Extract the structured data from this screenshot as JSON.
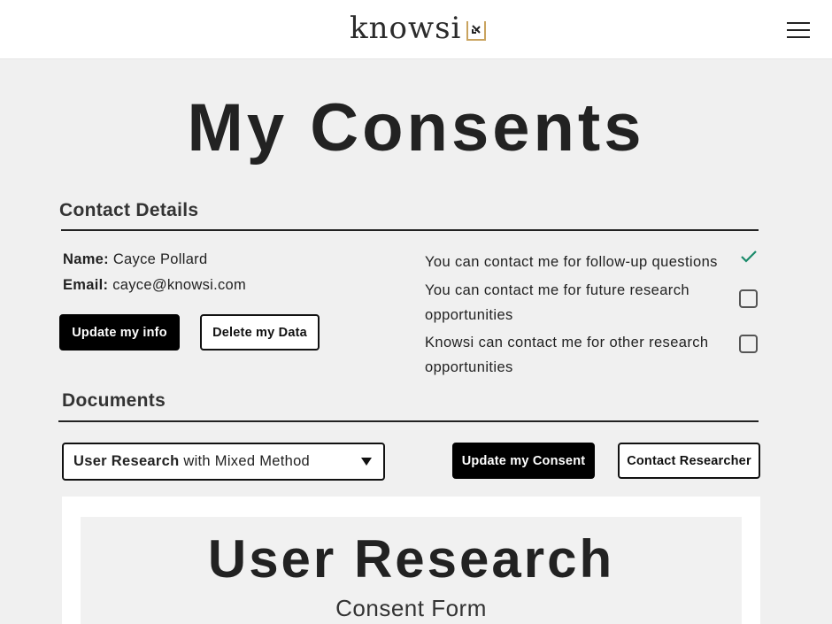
{
  "header": {
    "logo_text": "knowsi",
    "logo_icon": "knowsi-mark-icon",
    "menu_icon": "hamburger-menu-icon"
  },
  "page_title": "My Consents",
  "contact": {
    "heading": "Contact Details",
    "name_label": "Name:",
    "name_value": "Cayce Pollard",
    "email_label": "Email:",
    "email_value": "cayce@knowsi.com",
    "update_label": "Update my info",
    "delete_label": "Delete my Data"
  },
  "preferences": [
    {
      "label": "You can contact me for follow-up questions",
      "checked": true
    },
    {
      "label": "You can contact me for future research opportunities",
      "checked": false
    },
    {
      "label": "Knowsi can contact me for other research opportunities",
      "checked": false
    }
  ],
  "documents": {
    "heading": "Documents",
    "select_bold": "User Research",
    "select_rest": " with Mixed Method",
    "update_consent_label": "Update my Consent",
    "contact_researcher_label": "Contact Researcher"
  },
  "document_preview": {
    "title": "User Research",
    "subtitle": "Consent Form"
  },
  "colors": {
    "check_green": "#1a8a6a",
    "logo_gold": "#c9a35f",
    "background": "#f0f0f0"
  }
}
